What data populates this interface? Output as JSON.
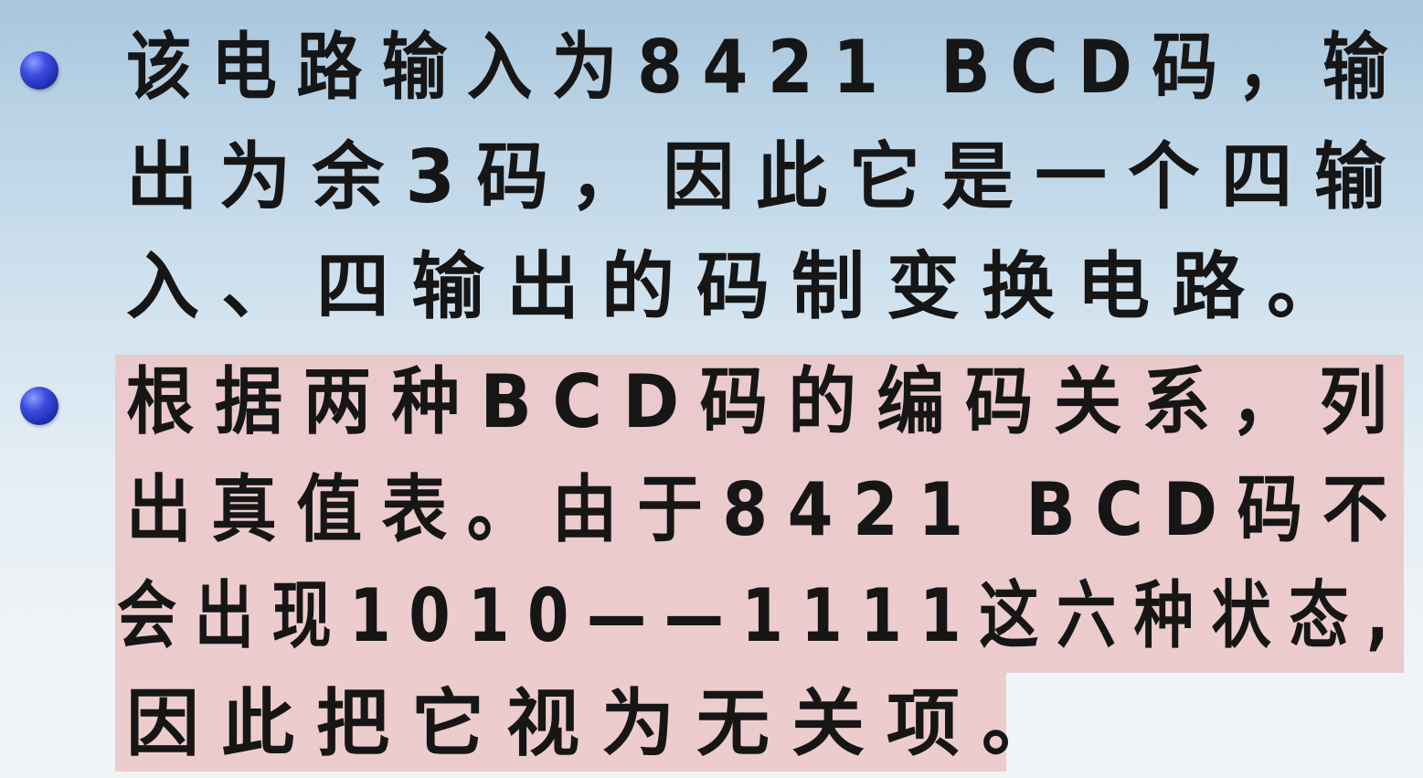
{
  "paragraphs": [
    {
      "lines": [
        "该电路输入为8421 BCD码，输",
        "出为余3码，因此它是一个四输",
        "入、四输出的码制变换电路。"
      ]
    },
    {
      "lines": [
        "根据两种BCD码的编码关系，列",
        "出真值表。由于8421 BCD码不",
        "会出现1010——1111这六种状态,",
        "因此把它视为无关项。"
      ]
    }
  ],
  "colors": {
    "bullet": "#2d3dd0",
    "highlight": "#ecc4c6",
    "text": "#161616"
  },
  "icons": {
    "bullet": "blue-sphere-bullet-icon"
  }
}
